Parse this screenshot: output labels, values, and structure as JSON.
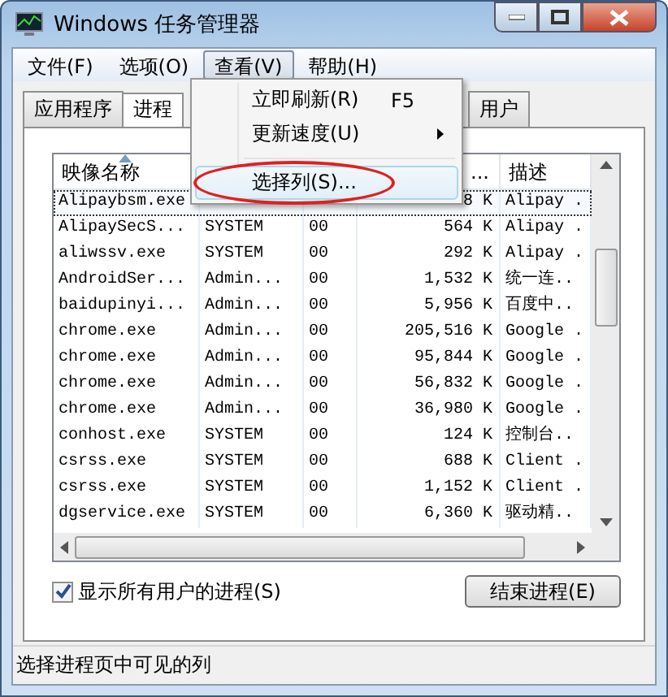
{
  "window": {
    "title": "Windows 任务管理器"
  },
  "menu_bar": [
    {
      "label": "文件(F)",
      "selected": false
    },
    {
      "label": "选项(O)",
      "selected": false
    },
    {
      "label": "查看(V)",
      "selected": true
    },
    {
      "label": "帮助(H)",
      "selected": false
    }
  ],
  "tabs": [
    {
      "label": "应用程序",
      "selected": false
    },
    {
      "label": "进程",
      "selected": true
    },
    {
      "label": "用户",
      "selected": false
    }
  ],
  "table": {
    "columns": [
      {
        "label": "映像名称",
        "sorted": true
      },
      {},
      {},
      {
        "label": "..."
      },
      {
        "label": "描述"
      }
    ],
    "rows": [
      {
        "selected": true,
        "cells": [
          "Alipaybsm.exe",
          "",
          "",
          "8 K",
          "Alipay ."
        ]
      },
      {
        "selected": false,
        "cells": [
          "AlipaySecS...",
          "SYSTEM",
          "00",
          "564 K",
          "Alipay ."
        ]
      },
      {
        "selected": false,
        "cells": [
          "aliwssv.exe",
          "SYSTEM",
          "00",
          "292 K",
          "Alipay ."
        ]
      },
      {
        "selected": false,
        "cells": [
          "AndroidSer...",
          "Admin...",
          "00",
          "1,532 K",
          "统一连.."
        ]
      },
      {
        "selected": false,
        "cells": [
          "baidupinyi...",
          "Admin...",
          "00",
          "5,956 K",
          "百度中.."
        ]
      },
      {
        "selected": false,
        "cells": [
          "chrome.exe",
          "Admin...",
          "00",
          "205,516 K",
          "Google ."
        ]
      },
      {
        "selected": false,
        "cells": [
          "chrome.exe",
          "Admin...",
          "00",
          "95,844 K",
          "Google ."
        ]
      },
      {
        "selected": false,
        "cells": [
          "chrome.exe",
          "Admin...",
          "00",
          "56,832 K",
          "Google ."
        ]
      },
      {
        "selected": false,
        "cells": [
          "chrome.exe",
          "Admin...",
          "00",
          "36,980 K",
          "Google ."
        ]
      },
      {
        "selected": false,
        "cells": [
          "conhost.exe",
          "SYSTEM",
          "00",
          "124 K",
          "控制台.."
        ]
      },
      {
        "selected": false,
        "cells": [
          "csrss.exe",
          "SYSTEM",
          "00",
          "688 K",
          "Client ."
        ]
      },
      {
        "selected": false,
        "cells": [
          "csrss.exe",
          "SYSTEM",
          "00",
          "1,152 K",
          "Client ."
        ]
      },
      {
        "selected": false,
        "cells": [
          "dgservice.exe",
          "SYSTEM",
          "00",
          "6,360 K",
          "驱动精.."
        ]
      }
    ]
  },
  "show_all_users": {
    "label": "显示所有用户的进程(S)",
    "checked": true
  },
  "end_button": "结束进程(E)",
  "dropdown": {
    "items": [
      {
        "kind": "item",
        "label": "立即刷新(R)",
        "shortcut": "F5",
        "highlighted": false
      },
      {
        "kind": "submenu",
        "label": "更新速度(U)",
        "highlighted": false
      },
      {
        "kind": "separator"
      },
      {
        "kind": "item",
        "label": "选择列(S)...",
        "highlighted": true
      }
    ]
  },
  "status_bar": "选择进程页中可见的列"
}
